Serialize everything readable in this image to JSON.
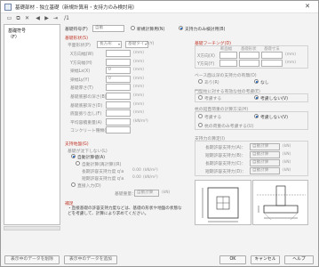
{
  "window": {
    "title": "基礎部材 - 独立基礎（新規計算用・支持力のみ検討用）"
  },
  "tree": {
    "items": [
      "基礎符号",
      "（F）"
    ]
  },
  "form": {
    "code_label": "基礎符号(F)",
    "code_value": "自動",
    "mode_new": "新規計算用(N)",
    "mode_support": "支持力のみ検討用(B)"
  },
  "shape": {
    "title": "基礎形状(S)",
    "plan_label": "平面形状(P)",
    "plan_value": "長方形",
    "type_label": "基礎タイプ(Y)",
    "rows": [
      {
        "label": "X方向幅(W)",
        "value": "",
        "unit": "(mm)"
      },
      {
        "label": "Y方向幅(H)",
        "value": "",
        "unit": "(mm)"
      },
      {
        "label": "梁幅Lx(X)",
        "value": "0",
        "unit": "(mm)"
      },
      {
        "label": "梁幅Ly(Y)",
        "value": "0",
        "unit": "(mm)"
      },
      {
        "label": "基礎厚さ(T)",
        "value": "",
        "unit": "(mm)"
      },
      {
        "label": "基礎底部の深さ(B)",
        "value": "",
        "unit": "(mm)"
      },
      {
        "label": "基礎底部深さ(D)",
        "value": "",
        "unit": "(mm)"
      },
      {
        "label": "底盤張り出し(F)",
        "value": "",
        "unit": "(mm)"
      },
      {
        "label": "平均容積重量(A)",
        "value": "",
        "unit": "(kN/m³)"
      },
      {
        "label": "コンクリート種類(K)",
        "value": "",
        "unit": ""
      }
    ]
  },
  "bearing": {
    "title": "支持地盤(G)",
    "sub_title": "基礎が沈下しない(L)",
    "options": [
      "自動計算値(A)",
      "自動計算(再計算)(R)",
      "直接入力(D)"
    ],
    "rows": [
      {
        "label": "長期許容支持力度 q'a",
        "value": "0.00",
        "unit": "(kN/m²)"
      },
      {
        "label": "短期許容支持力度 q'a",
        "value": "0.00",
        "unit": "(kN/m²)"
      }
    ],
    "stress_label": "基礎重量：",
    "stress_value": "自動計算",
    "stress_unit": "(kN)",
    "note_title": "補足",
    "note_text": "・直接基礎の許容支持力度などは、基礎の形状や地盤の状態などを考慮して、計算により求めてください。"
  },
  "right": {
    "plan_title": "基礎フーチング(D)",
    "plan_headers": [
      "断面幅",
      "基礎形状",
      "基礎寸法"
    ],
    "plan_rows": [
      {
        "label": "X方向(X)",
        "v1": "",
        "v2": "",
        "v3": ""
      },
      {
        "label": "Y方向(Y)",
        "v1": "",
        "v2": "",
        "v3": ""
      }
    ],
    "plan_units": [
      "(mm)",
      "(mm)"
    ],
    "soil_title": "ベース面以深の支持力の有無(O)",
    "soil_opts": [
      "あり(R)",
      "なし"
    ],
    "col_title": "門型柱に対する有効な柱の考慮(E)",
    "col_opts": [
      "考慮する",
      "考慮しない(V)"
    ],
    "mode_title": "杭の鉛直荷重の計算方法(H)",
    "mode_opts": [
      "考慮する",
      "考慮しない(V)",
      "杭の荷重のみ考慮する(U)"
    ],
    "force_title": "支持力の算定(I)",
    "force_rows": [
      {
        "label": "長期許容支持力(A)：",
        "value": "自動計算",
        "unit": "(kN)"
      },
      {
        "label": "短期許容支持力(B)：",
        "value": "自動計算",
        "unit": "(kN)"
      },
      {
        "label": "長期許容支持力(C)：",
        "value": "自動計算",
        "unit": "(kN)"
      },
      {
        "label": "短期許容支持力(D)：",
        "value": "自動計算",
        "unit": "(kN)"
      }
    ]
  },
  "footer": {
    "btn_copy": "表示中のデータを削除",
    "btn_apply": "表示中のデータを追加",
    "btn_ok": "OK",
    "btn_cancel": "キャンセル",
    "btn_help": "ヘルプ"
  }
}
